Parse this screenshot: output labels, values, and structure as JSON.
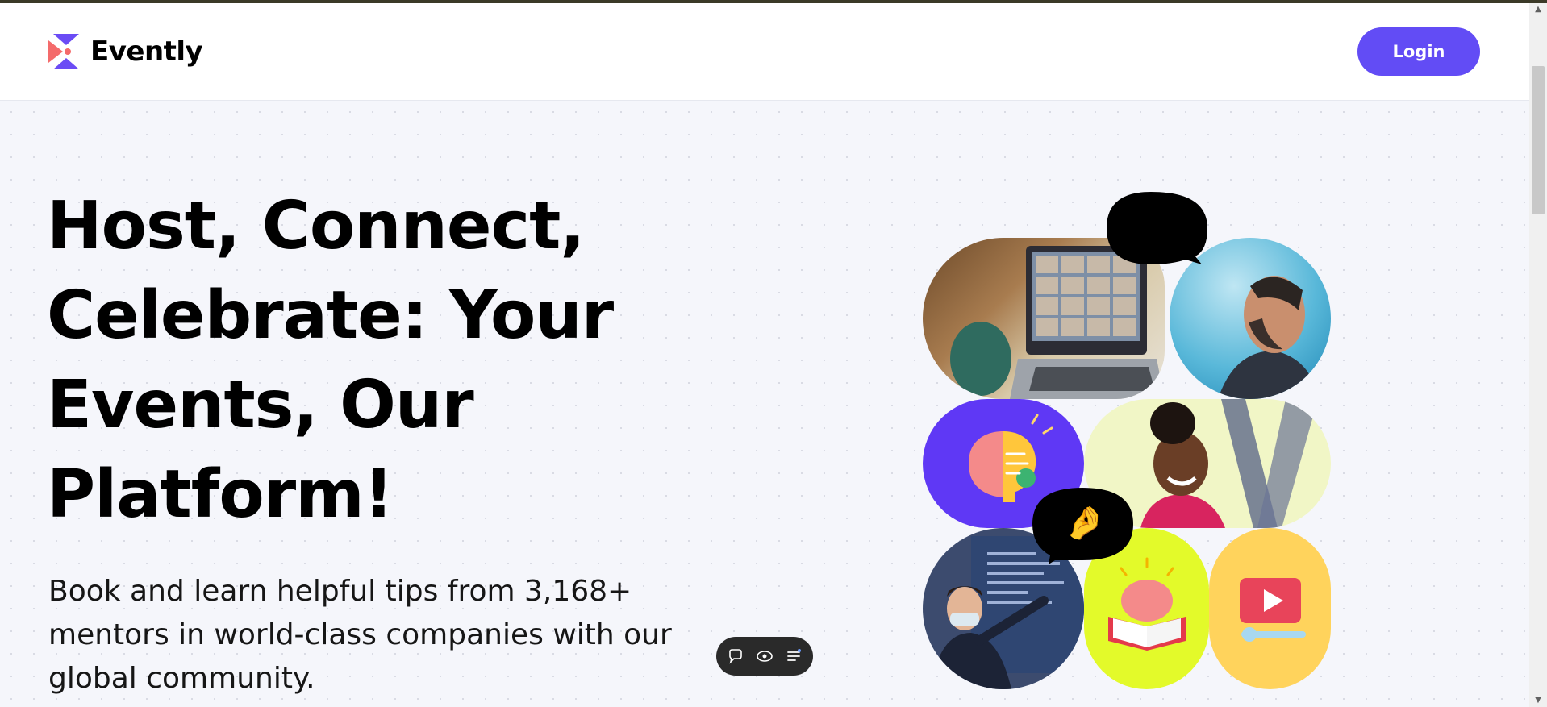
{
  "brand": {
    "name": "Evently",
    "accent": "#624cf5",
    "logo_colors": [
      "#6b4cf5",
      "#f46b6b"
    ]
  },
  "nav": {
    "login_label": "Login"
  },
  "hero": {
    "title": "Host, Connect, Celebrate: Your Events, Our Platform!",
    "subtitle": "Book and learn helpful tips from 3,168+ mentors in world-class companies with our global community."
  },
  "collage": {
    "tiles": [
      "laptop-video-call-photo",
      "smiling-man-photo",
      "brain-lightbulb-icon",
      "smiling-woman-photo",
      "presenter-screen-photo",
      "brain-book-icon",
      "video-play-icon"
    ],
    "emojis": [
      "😍",
      "🤌"
    ]
  },
  "toolbar": {
    "icons": [
      "comment-icon",
      "eye-icon",
      "menu-icon"
    ]
  }
}
